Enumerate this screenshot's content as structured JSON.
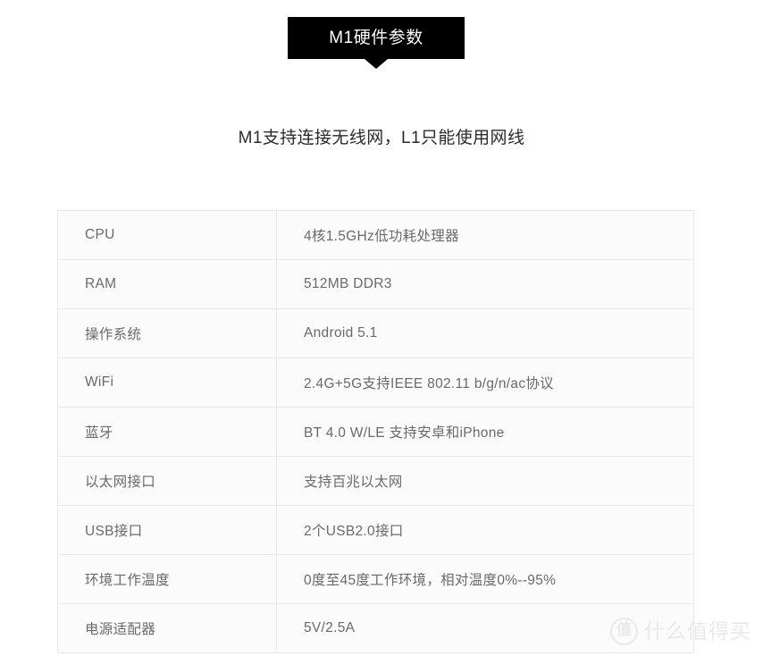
{
  "banner": {
    "title": "M1硬件参数",
    "background_color": "#000000",
    "text_color": "#ffffff"
  },
  "subtitle": {
    "text": "M1支持连接无线网，L1只能使用网线"
  },
  "spec_table": {
    "rows": [
      {
        "label": "CPU",
        "value": "4核1.5GHz低功耗处理器"
      },
      {
        "label": "RAM",
        "value": "512MB DDR3"
      },
      {
        "label": "操作系统",
        "value": "Android 5.1"
      },
      {
        "label": "WiFi",
        "value": "2.4G+5G支持IEEE 802.11 b/g/n/ac协议"
      },
      {
        "label": "蓝牙",
        "value": "BT 4.0 W/LE 支持安卓和iPhone"
      },
      {
        "label": "以太网接口",
        "value": "支持百兆以太网"
      },
      {
        "label": "USB接口",
        "value": "2个USB2.0接口"
      },
      {
        "label": "环境工作温度",
        "value": "0度至45度工作环境，相对温度0%--95%"
      },
      {
        "label": "电源适配器",
        "value": "5V/2.5A"
      }
    ],
    "border_color": "#e8e8e8",
    "cell_background": "#fbfbfb",
    "text_color": "#6a6a6a"
  },
  "watermark": {
    "mark": "值",
    "text": "什么值得买",
    "color": "#e9e9e9"
  }
}
